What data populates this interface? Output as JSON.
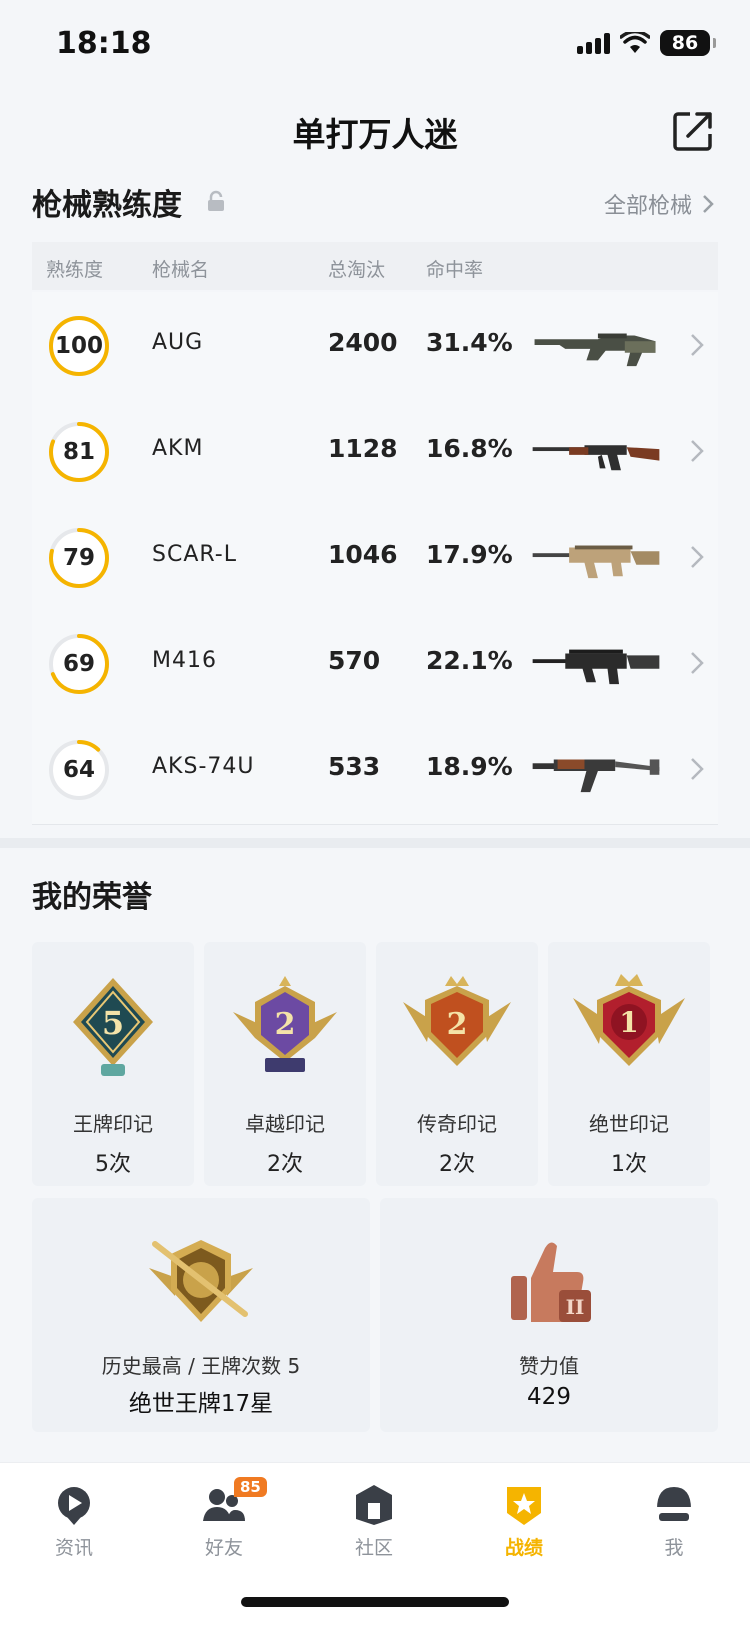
{
  "status_bar": {
    "time": "18:18",
    "battery": "86"
  },
  "header": {
    "title": "单打万人迷"
  },
  "weapons": {
    "section_title": "枪械熟练度",
    "all_link": "全部枪械",
    "columns": {
      "proficiency": "熟练度",
      "name": "枪械名",
      "kills": "总淘汰",
      "accuracy": "命中率"
    },
    "rows": [
      {
        "proficiency": "100",
        "level_pct": 1.0,
        "name": "AUG",
        "kills": "2400",
        "accuracy": "31.4%",
        "gun_icon": "aug-rifle-icon"
      },
      {
        "proficiency": "81",
        "level_pct": 0.81,
        "name": "AKM",
        "kills": "1128",
        "accuracy": "16.8%",
        "gun_icon": "akm-rifle-icon"
      },
      {
        "proficiency": "79",
        "level_pct": 0.79,
        "name": "SCAR-L",
        "kills": "1046",
        "accuracy": "17.9%",
        "gun_icon": "scar-rifle-icon"
      },
      {
        "proficiency": "69",
        "level_pct": 0.69,
        "name": "M416",
        "kills": "570",
        "accuracy": "22.1%",
        "gun_icon": "m416-rifle-icon"
      },
      {
        "proficiency": "64",
        "level_pct": 0.12,
        "name": "AKS-74U",
        "kills": "533",
        "accuracy": "18.9%",
        "gun_icon": "aks74u-rifle-icon"
      }
    ]
  },
  "honors": {
    "section_title": "我的荣誉",
    "marks": [
      {
        "label": "王牌印记",
        "count": "5次",
        "badge_num": "5"
      },
      {
        "label": "卓越印记",
        "count": "2次",
        "badge_num": "2"
      },
      {
        "label": "传奇印记",
        "count": "2次",
        "badge_num": "2"
      },
      {
        "label": "绝世印记",
        "count": "1次",
        "badge_num": "1"
      }
    ],
    "highest": {
      "label": "历史最高 / 王牌次数 5",
      "value": "绝世王牌17星"
    },
    "likes": {
      "label": "赞力值",
      "value": "429",
      "badge_mark": "II"
    }
  },
  "bottom_nav": {
    "items": [
      {
        "label": "资讯"
      },
      {
        "label": "好友",
        "badge": "85"
      },
      {
        "label": "社区"
      },
      {
        "label": "战绩"
      },
      {
        "label": "我"
      }
    ]
  },
  "colors": {
    "accent": "#f5b400",
    "ring_track": "#e6e8eb",
    "nav_badge": "#f07a22"
  }
}
